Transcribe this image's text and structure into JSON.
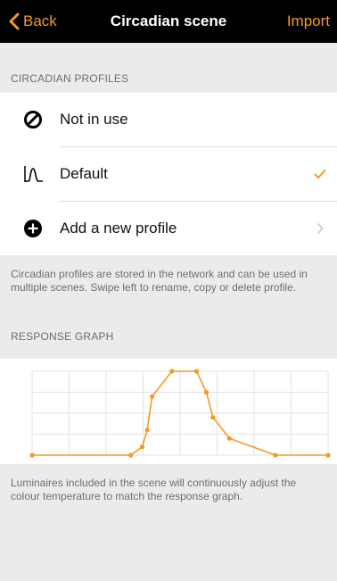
{
  "navbar": {
    "back_label": "Back",
    "title": "Circadian scene",
    "import_label": "Import",
    "accent_color": "#f59a23"
  },
  "profiles_section": {
    "header": "CIRCADIAN PROFILES",
    "items": [
      {
        "label": "Not in use",
        "icon": "prohibited-icon"
      },
      {
        "label": "Default",
        "icon": "curve-icon",
        "selected": true
      },
      {
        "label": "Add a new profile",
        "icon": "plus-circle-icon"
      }
    ],
    "note": "Circadian profiles are stored in the network and can be used in multiple scenes. Swipe left to rename, copy or delete profile."
  },
  "graph_section": {
    "header": "RESPONSE GRAPH",
    "note": "Luminaires included in the scene will continuously adjust the colour temperature to match the response graph."
  },
  "chart_data": {
    "type": "line",
    "x": [
      0,
      6,
      6.7,
      7,
      7.3,
      8.5,
      10,
      10.6,
      11,
      12,
      14.8,
      18
    ],
    "y": [
      0,
      0,
      0.1,
      0.3,
      0.7,
      1,
      1,
      0.75,
      0.45,
      0.2,
      0,
      0
    ],
    "xlim": [
      0,
      18
    ],
    "ylim": [
      0,
      1
    ],
    "grid": true,
    "line_color": "#f59a23"
  }
}
